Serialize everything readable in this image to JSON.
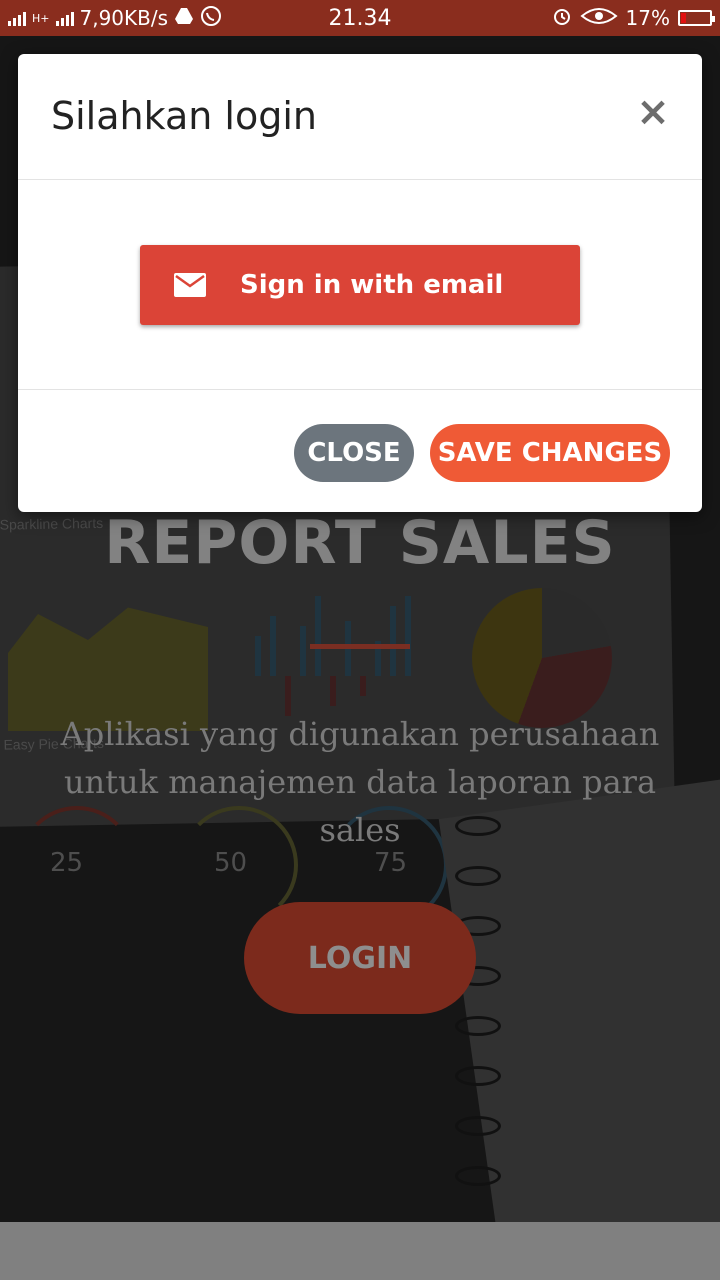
{
  "status_bar": {
    "network_speed": "7,90KB/s",
    "time": "21.34",
    "battery_percent": "17%",
    "battery_level": 0.17,
    "network_type": "H+",
    "icons": [
      "signal-icon",
      "drive-icon",
      "whatsapp-icon",
      "alarm-icon",
      "eye-icon",
      "battery-icon"
    ]
  },
  "background_page": {
    "title": "REPORT SALES",
    "subtitle": "Aplikasi yang digunakan perusahaan untuk manajemen data laporan para sales",
    "login_button": "LOGIN",
    "photo_labels": {
      "sparkline": "Sparkline Charts",
      "easy_pie": "Easy Pie Charts",
      "gauge_25": "25",
      "gauge_50": "50",
      "gauge_75": "75"
    }
  },
  "modal": {
    "title": "Silahkan login",
    "close_icon": "close-icon",
    "email_button": {
      "label": "Sign in with email",
      "icon": "mail-icon",
      "color": "#db4437"
    },
    "footer": {
      "close_label": "CLOSE",
      "save_label": "SAVE CHANGES"
    }
  },
  "colors": {
    "status_bar": "#8a2d1e",
    "close_button": "#6c757d",
    "save_button": "#ef5a36"
  }
}
